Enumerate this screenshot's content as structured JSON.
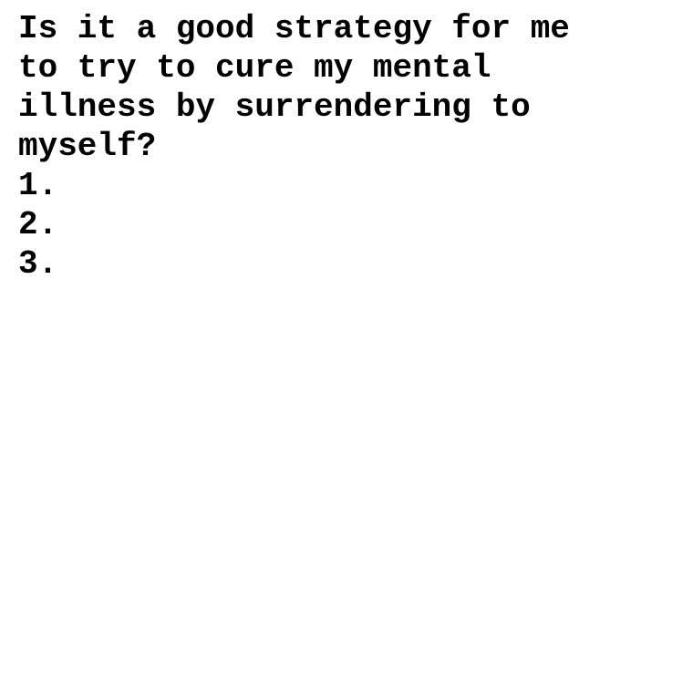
{
  "question": "Is it a good strategy for me\nto try to cure my mental\nillness by surrendering to\nmyself?",
  "items": [
    {
      "marker": "1.",
      "text": ""
    },
    {
      "marker": "2.",
      "text": ""
    },
    {
      "marker": "3.",
      "text": ""
    }
  ],
  "colors": {
    "text": "#000000",
    "background": "#ffffff"
  }
}
